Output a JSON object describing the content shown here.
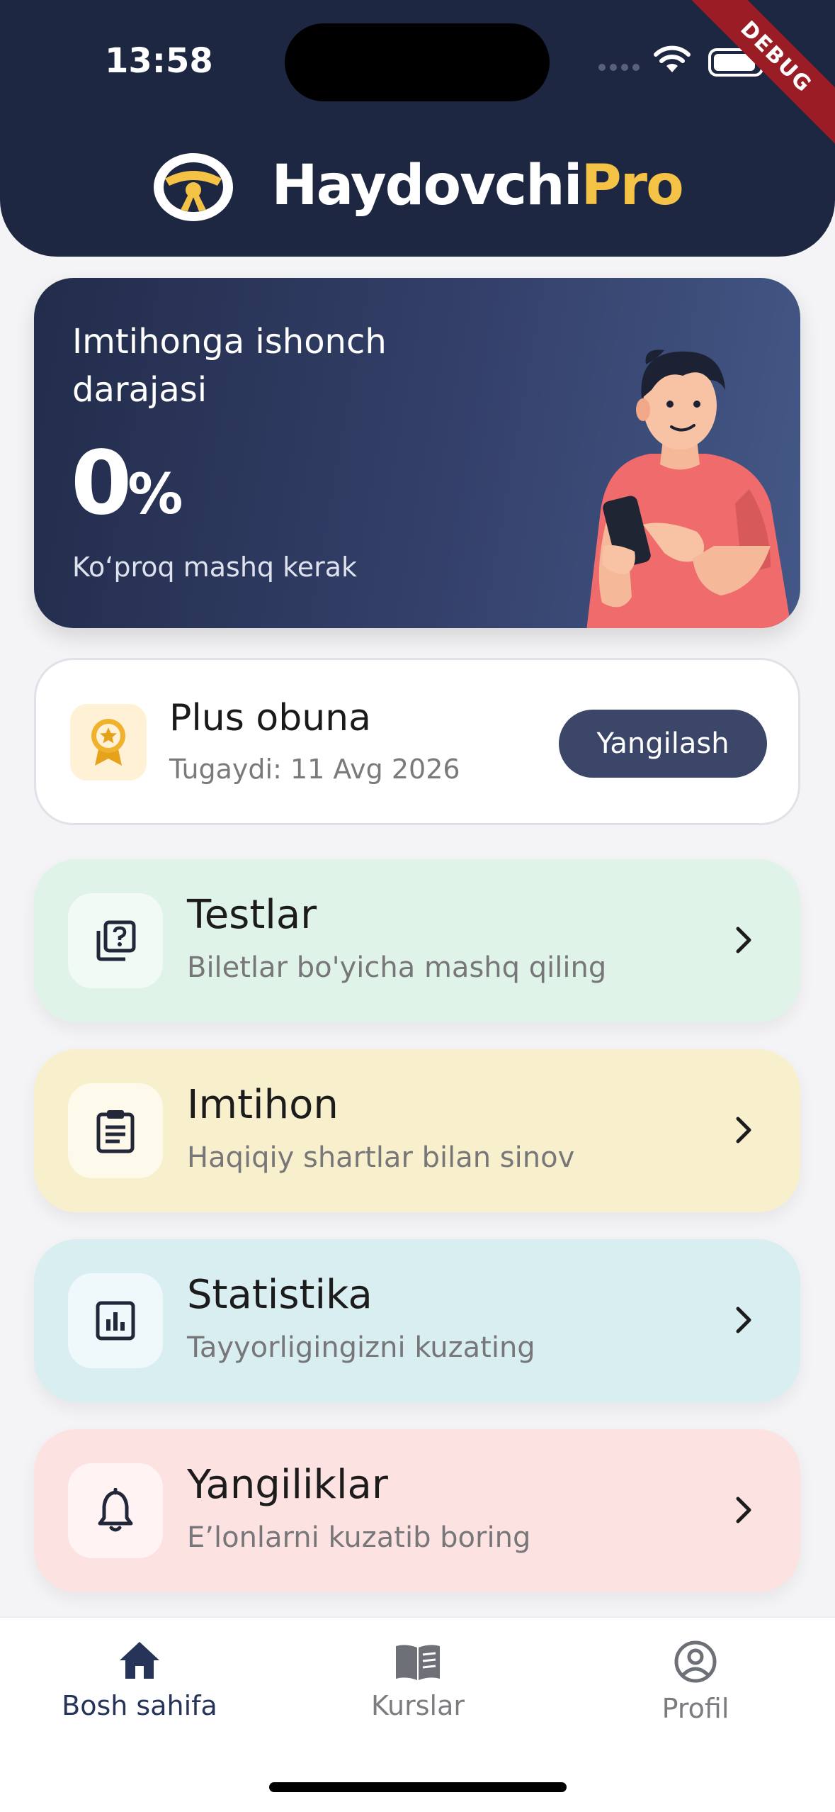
{
  "status_bar": {
    "time": "13:58",
    "debug_label": "DEBUG"
  },
  "header": {
    "brand_main": "Haydovchi",
    "brand_accent": "Pro"
  },
  "hero": {
    "title": "Imtihonga ishonch darajasi",
    "percent_value": "0",
    "percent_sign": "%",
    "subtitle": "Ko‘proq mashq kerak"
  },
  "subscription": {
    "title": "Plus obuna",
    "expiry": "Tugaydi: 11 Avg 2026",
    "button_label": "Yangilash"
  },
  "menu": [
    {
      "title": "Testlar",
      "subtitle": "Biletlar bo'yicha mashq qiling",
      "bg": "#dff3e8",
      "icon": "quiz-icon"
    },
    {
      "title": "Imtihon",
      "subtitle": "Haqiqiy shartlar bilan sinov",
      "bg": "#f8f0cd",
      "icon": "clipboard-icon"
    },
    {
      "title": "Statistika",
      "subtitle": "Tayyorligingizni kuzating",
      "bg": "#d9eef1",
      "icon": "bar-chart-icon"
    },
    {
      "title": "Yangiliklar",
      "subtitle": "E’lonlarni kuzatib boring",
      "bg": "#fde2e2",
      "icon": "bell-icon"
    }
  ],
  "bottom_nav": [
    {
      "label": "Bosh sahifa",
      "icon": "home-icon",
      "active": true
    },
    {
      "label": "Kurslar",
      "icon": "book-icon",
      "active": false
    },
    {
      "label": "Profil",
      "icon": "profile-icon",
      "active": false
    }
  ],
  "colors": {
    "navy": "#1e2742",
    "accent_yellow": "#f4c245",
    "button": "#3c4668",
    "nav_active": "#26345a",
    "nav_inactive": "#7c7c80"
  }
}
